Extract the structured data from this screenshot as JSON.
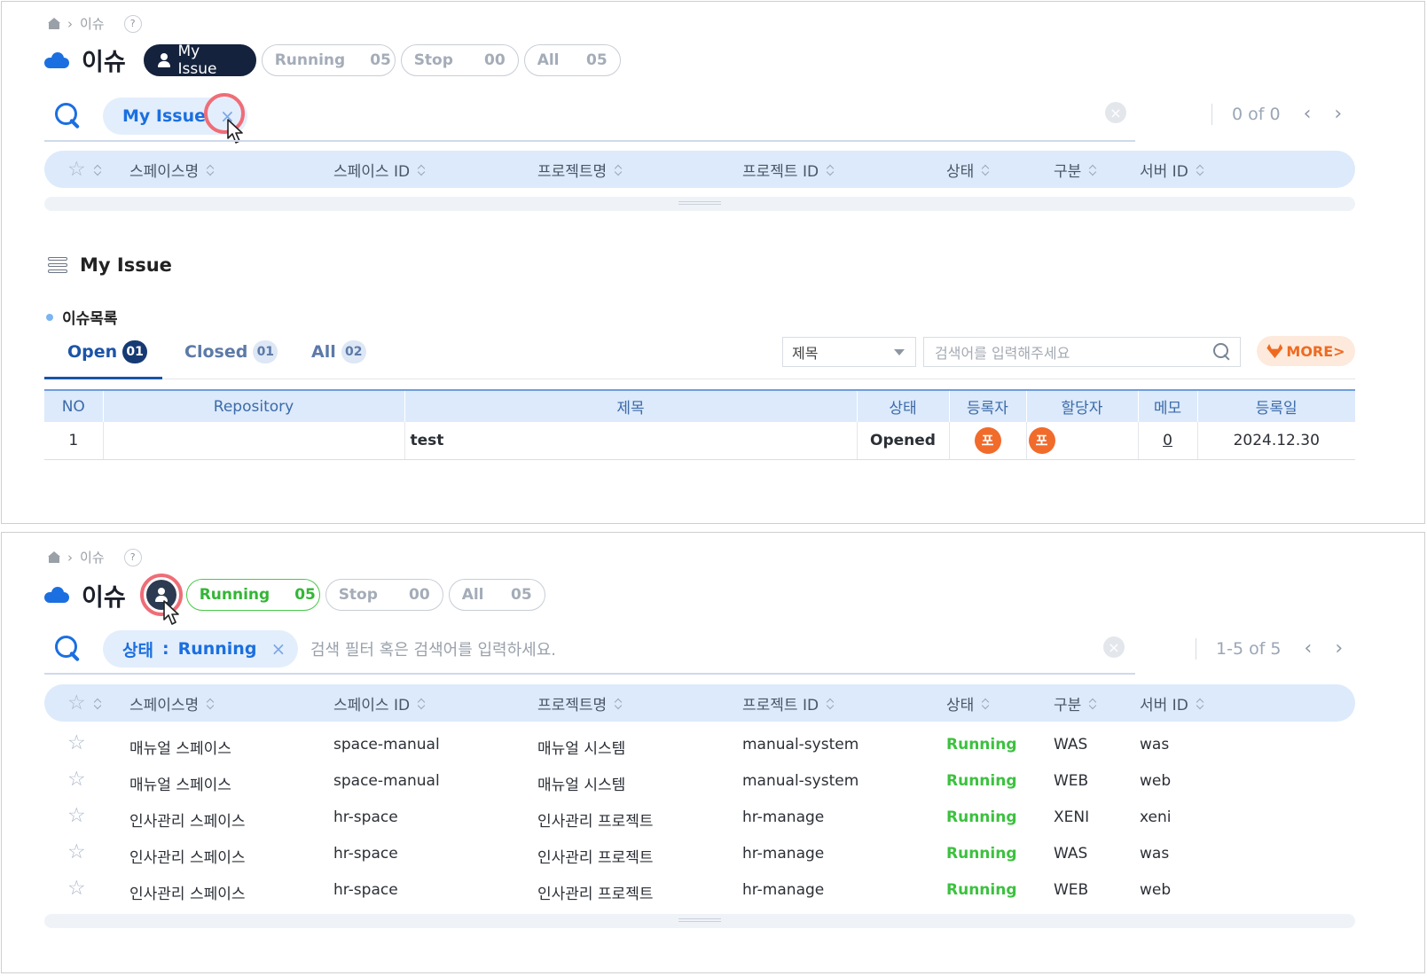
{
  "top": {
    "breadcrumb": {
      "current": "이슈",
      "help": "?"
    },
    "title": "이슈",
    "filters": [
      {
        "label": "My Issue",
        "count": ""
      },
      {
        "label": "Running",
        "count": "05"
      },
      {
        "label": "Stop",
        "count": "00"
      },
      {
        "label": "All",
        "count": "05"
      }
    ],
    "search": {
      "chip": "My Issue",
      "chip_close": "×",
      "clear": "×",
      "pager": "0 of 0",
      "prev": "‹",
      "next": "›"
    },
    "columns": [
      "스페이스명",
      "스페이스 ID",
      "프로젝트명",
      "프로젝트 ID",
      "상태",
      "구분",
      "서버 ID"
    ],
    "section_title": "My Issue",
    "sub_title": "이슈목록",
    "tabs": [
      {
        "label": "Open",
        "count": "01"
      },
      {
        "label": "Closed",
        "count": "01"
      },
      {
        "label": "All",
        "count": "02"
      }
    ],
    "select_value": "제목",
    "keyword_placeholder": "검색어를 입력해주세요",
    "more_label": "MORE>",
    "issue_table": {
      "headers": [
        "NO",
        "Repository",
        "제목",
        "상태",
        "등록자",
        "할당자",
        "메모",
        "등록일"
      ],
      "rows": [
        {
          "no": "1",
          "repository": "",
          "title": "test",
          "status": "Opened",
          "author": "포",
          "assignee": "포",
          "memo": "0",
          "date": "2024.12.30"
        }
      ]
    }
  },
  "bottom": {
    "breadcrumb": {
      "current": "이슈",
      "help": "?"
    },
    "title": "이슈",
    "filters": [
      {
        "label": "Running",
        "count": "05"
      },
      {
        "label": "Stop",
        "count": "00"
      },
      {
        "label": "All",
        "count": "05"
      }
    ],
    "search": {
      "chip_key": "상태",
      "chip_sep": ":",
      "chip_value": "Running",
      "chip_close": "×",
      "placeholder": "검색 필터 혹은 검색어를 입력하세요.",
      "clear": "×",
      "pager": "1-5 of 5",
      "prev": "‹",
      "next": "›"
    },
    "columns": [
      "스페이스명",
      "스페이스 ID",
      "프로젝트명",
      "프로젝트 ID",
      "상태",
      "구분",
      "서버 ID"
    ],
    "rows": [
      {
        "space_name": "매뉴얼 스페이스",
        "space_id": "space-manual",
        "project_name": "매뉴얼 시스템",
        "project_id": "manual-system",
        "status": "Running",
        "type": "WAS",
        "server_id": "was"
      },
      {
        "space_name": "매뉴얼 스페이스",
        "space_id": "space-manual",
        "project_name": "매뉴얼 시스템",
        "project_id": "manual-system",
        "status": "Running",
        "type": "WEB",
        "server_id": "web"
      },
      {
        "space_name": "인사관리 스페이스",
        "space_id": "hr-space",
        "project_name": "인사관리 프로젝트",
        "project_id": "hr-manage",
        "status": "Running",
        "type": "XENI",
        "server_id": "xeni"
      },
      {
        "space_name": "인사관리 스페이스",
        "space_id": "hr-space",
        "project_name": "인사관리 프로젝트",
        "project_id": "hr-manage",
        "status": "Running",
        "type": "WAS",
        "server_id": "was"
      },
      {
        "space_name": "인사관리 스페이스",
        "space_id": "hr-space",
        "project_name": "인사관리 프로젝트",
        "project_id": "hr-manage",
        "status": "Running",
        "type": "WEB",
        "server_id": "web"
      }
    ]
  },
  "colors": {
    "primary": "#1b6fe0",
    "navy": "#14223d",
    "running_green": "#3cc13f",
    "highlight_ring": "#ef6d77",
    "gitlab_orange": "#ef6a21"
  }
}
